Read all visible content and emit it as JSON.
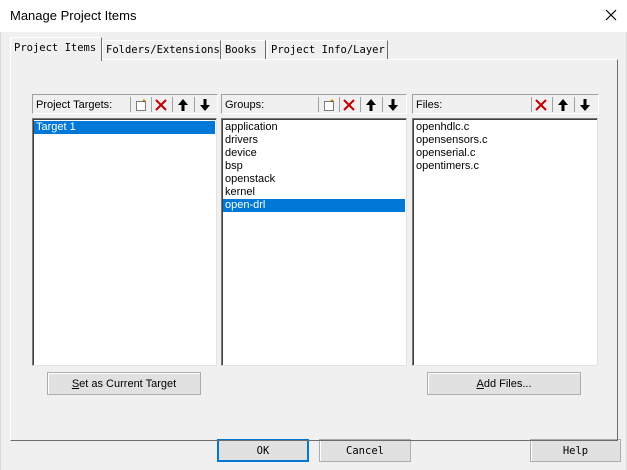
{
  "window": {
    "title": "Manage Project Items"
  },
  "tabs": [
    {
      "label": "Project Items",
      "active": true
    },
    {
      "label": "Folders/Extensions",
      "active": false
    },
    {
      "label": "Books",
      "active": false
    },
    {
      "label": "Project Info/Layer",
      "active": false
    }
  ],
  "targets": {
    "header": "Project Targets:",
    "items": [
      "Target 1"
    ],
    "selected_index": 0,
    "button_label": "Set as Current Target",
    "button_accel": "S",
    "button_rest": "et as Current Target"
  },
  "groups": {
    "header": "Groups:",
    "items": [
      "application",
      "drivers",
      "device",
      "bsp",
      "openstack",
      "kernel",
      "open-drl"
    ],
    "selected_index": 6
  },
  "files": {
    "header": "Files:",
    "items": [
      "openhdlc.c",
      "opensensors.c",
      "openserial.c",
      "opentimers.c"
    ],
    "button_label": "Add Files...",
    "button_accel": "A",
    "button_rest": "dd Files..."
  },
  "footer": {
    "ok": "OK",
    "cancel": "Cancel",
    "help": "Help"
  },
  "colors": {
    "selection": "#0078d7",
    "delete_red": "#c00000",
    "dialog_bg": "#f0f0f0"
  },
  "icons": {
    "new": "new-item-icon",
    "delete": "delete-x-icon",
    "up": "move-up-arrow-icon",
    "down": "move-down-arrow-icon",
    "close": "close-icon"
  }
}
